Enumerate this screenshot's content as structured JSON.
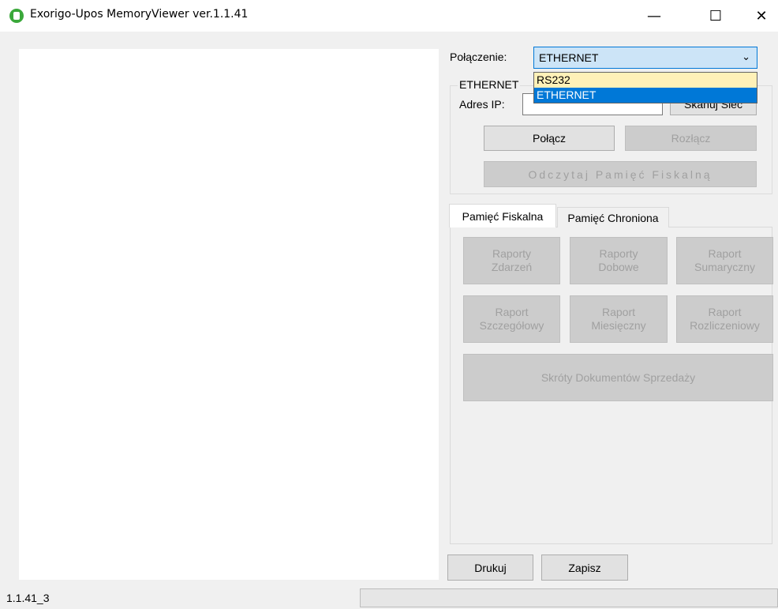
{
  "window": {
    "title": "Exorigo-Upos MemoryViewer ver.1.1.41",
    "minimize_glyph": "—",
    "maximize_glyph": "☐",
    "close_glyph": "✕"
  },
  "connection": {
    "label": "Połączenie:",
    "selected": "ETHERNET",
    "options": [
      "RS232",
      "ETHERNET"
    ],
    "highlight_color": "#0078d7",
    "hover_color": "#fff1b8"
  },
  "ethernet_group": {
    "title": "ETHERNET",
    "ip_label": "Adres IP:",
    "ip_value": "",
    "scan_button": "Skanuj Sieć",
    "connect_button": "Połącz",
    "disconnect_button": "Rozłącz",
    "read_memory_button": "Odczytaj Pamięć Fiskalną"
  },
  "tabs": [
    {
      "label": "Pamięć Fiskalna",
      "active": true
    },
    {
      "label": "Pamięć Chroniona",
      "active": false
    }
  ],
  "reports": {
    "events": [
      "Raporty",
      "Zdarzeń"
    ],
    "daily": [
      "Raporty",
      "Dobowe"
    ],
    "summary": [
      "Raport",
      "Sumaryczny"
    ],
    "detailed": [
      "Raport",
      "Szczegółowy"
    ],
    "monthly": [
      "Raport",
      "Miesięczny"
    ],
    "settlement": [
      "Raport",
      "Rozliczeniowy"
    ],
    "sales_digests": "Skróty Dokumentów Sprzedaży"
  },
  "footer": {
    "print_button": "Drukuj",
    "save_button": "Zapisz"
  },
  "status": {
    "version": "1.1.41_3"
  }
}
